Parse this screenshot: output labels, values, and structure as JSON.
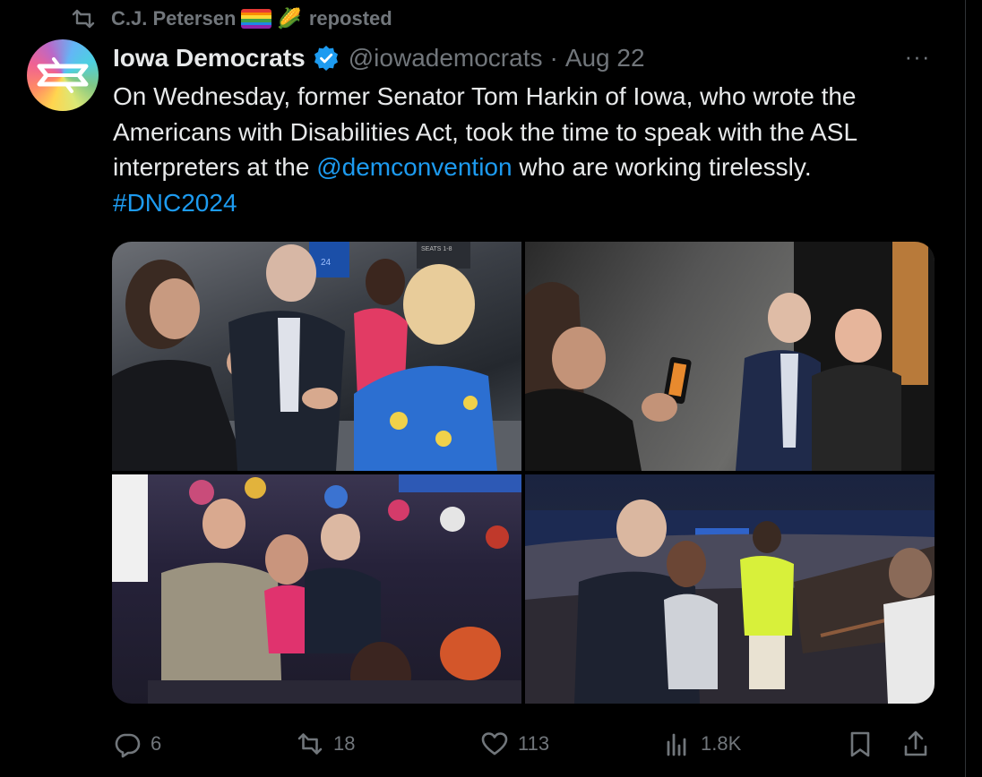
{
  "repost": {
    "reposter_name": "C.J. Petersen",
    "corn_emoji": "🌽",
    "label": "reposted",
    "icon": "repost-icon"
  },
  "tweet": {
    "display_name": "Iowa Democrats",
    "handle": "@iowademocrats",
    "separator": "·",
    "date": "Aug 22",
    "verified_color": "#1d9bf0",
    "text_1": "On Wednesday, former Senator Tom Harkin of Iowa, who wrote the Americans with Disabilities Act, took the time to speak with the ASL interpreters at the ",
    "mention": "@demconvention",
    "text_2": " who are working tirelessly. ",
    "hashtag": "#DNC2024",
    "link_color": "#1d9bf0"
  },
  "media": {
    "photos": [
      "photo-1",
      "photo-2",
      "photo-3",
      "photo-4"
    ],
    "photo1_sign": "SEATS 1-8",
    "photo1_screen": "24"
  },
  "actions": {
    "replies": "6",
    "reposts": "18",
    "likes": "113",
    "views": "1.8K",
    "icons": [
      "reply-icon",
      "repost-icon",
      "like-icon",
      "views-icon",
      "bookmark-icon",
      "share-icon"
    ]
  },
  "more_label": "···"
}
